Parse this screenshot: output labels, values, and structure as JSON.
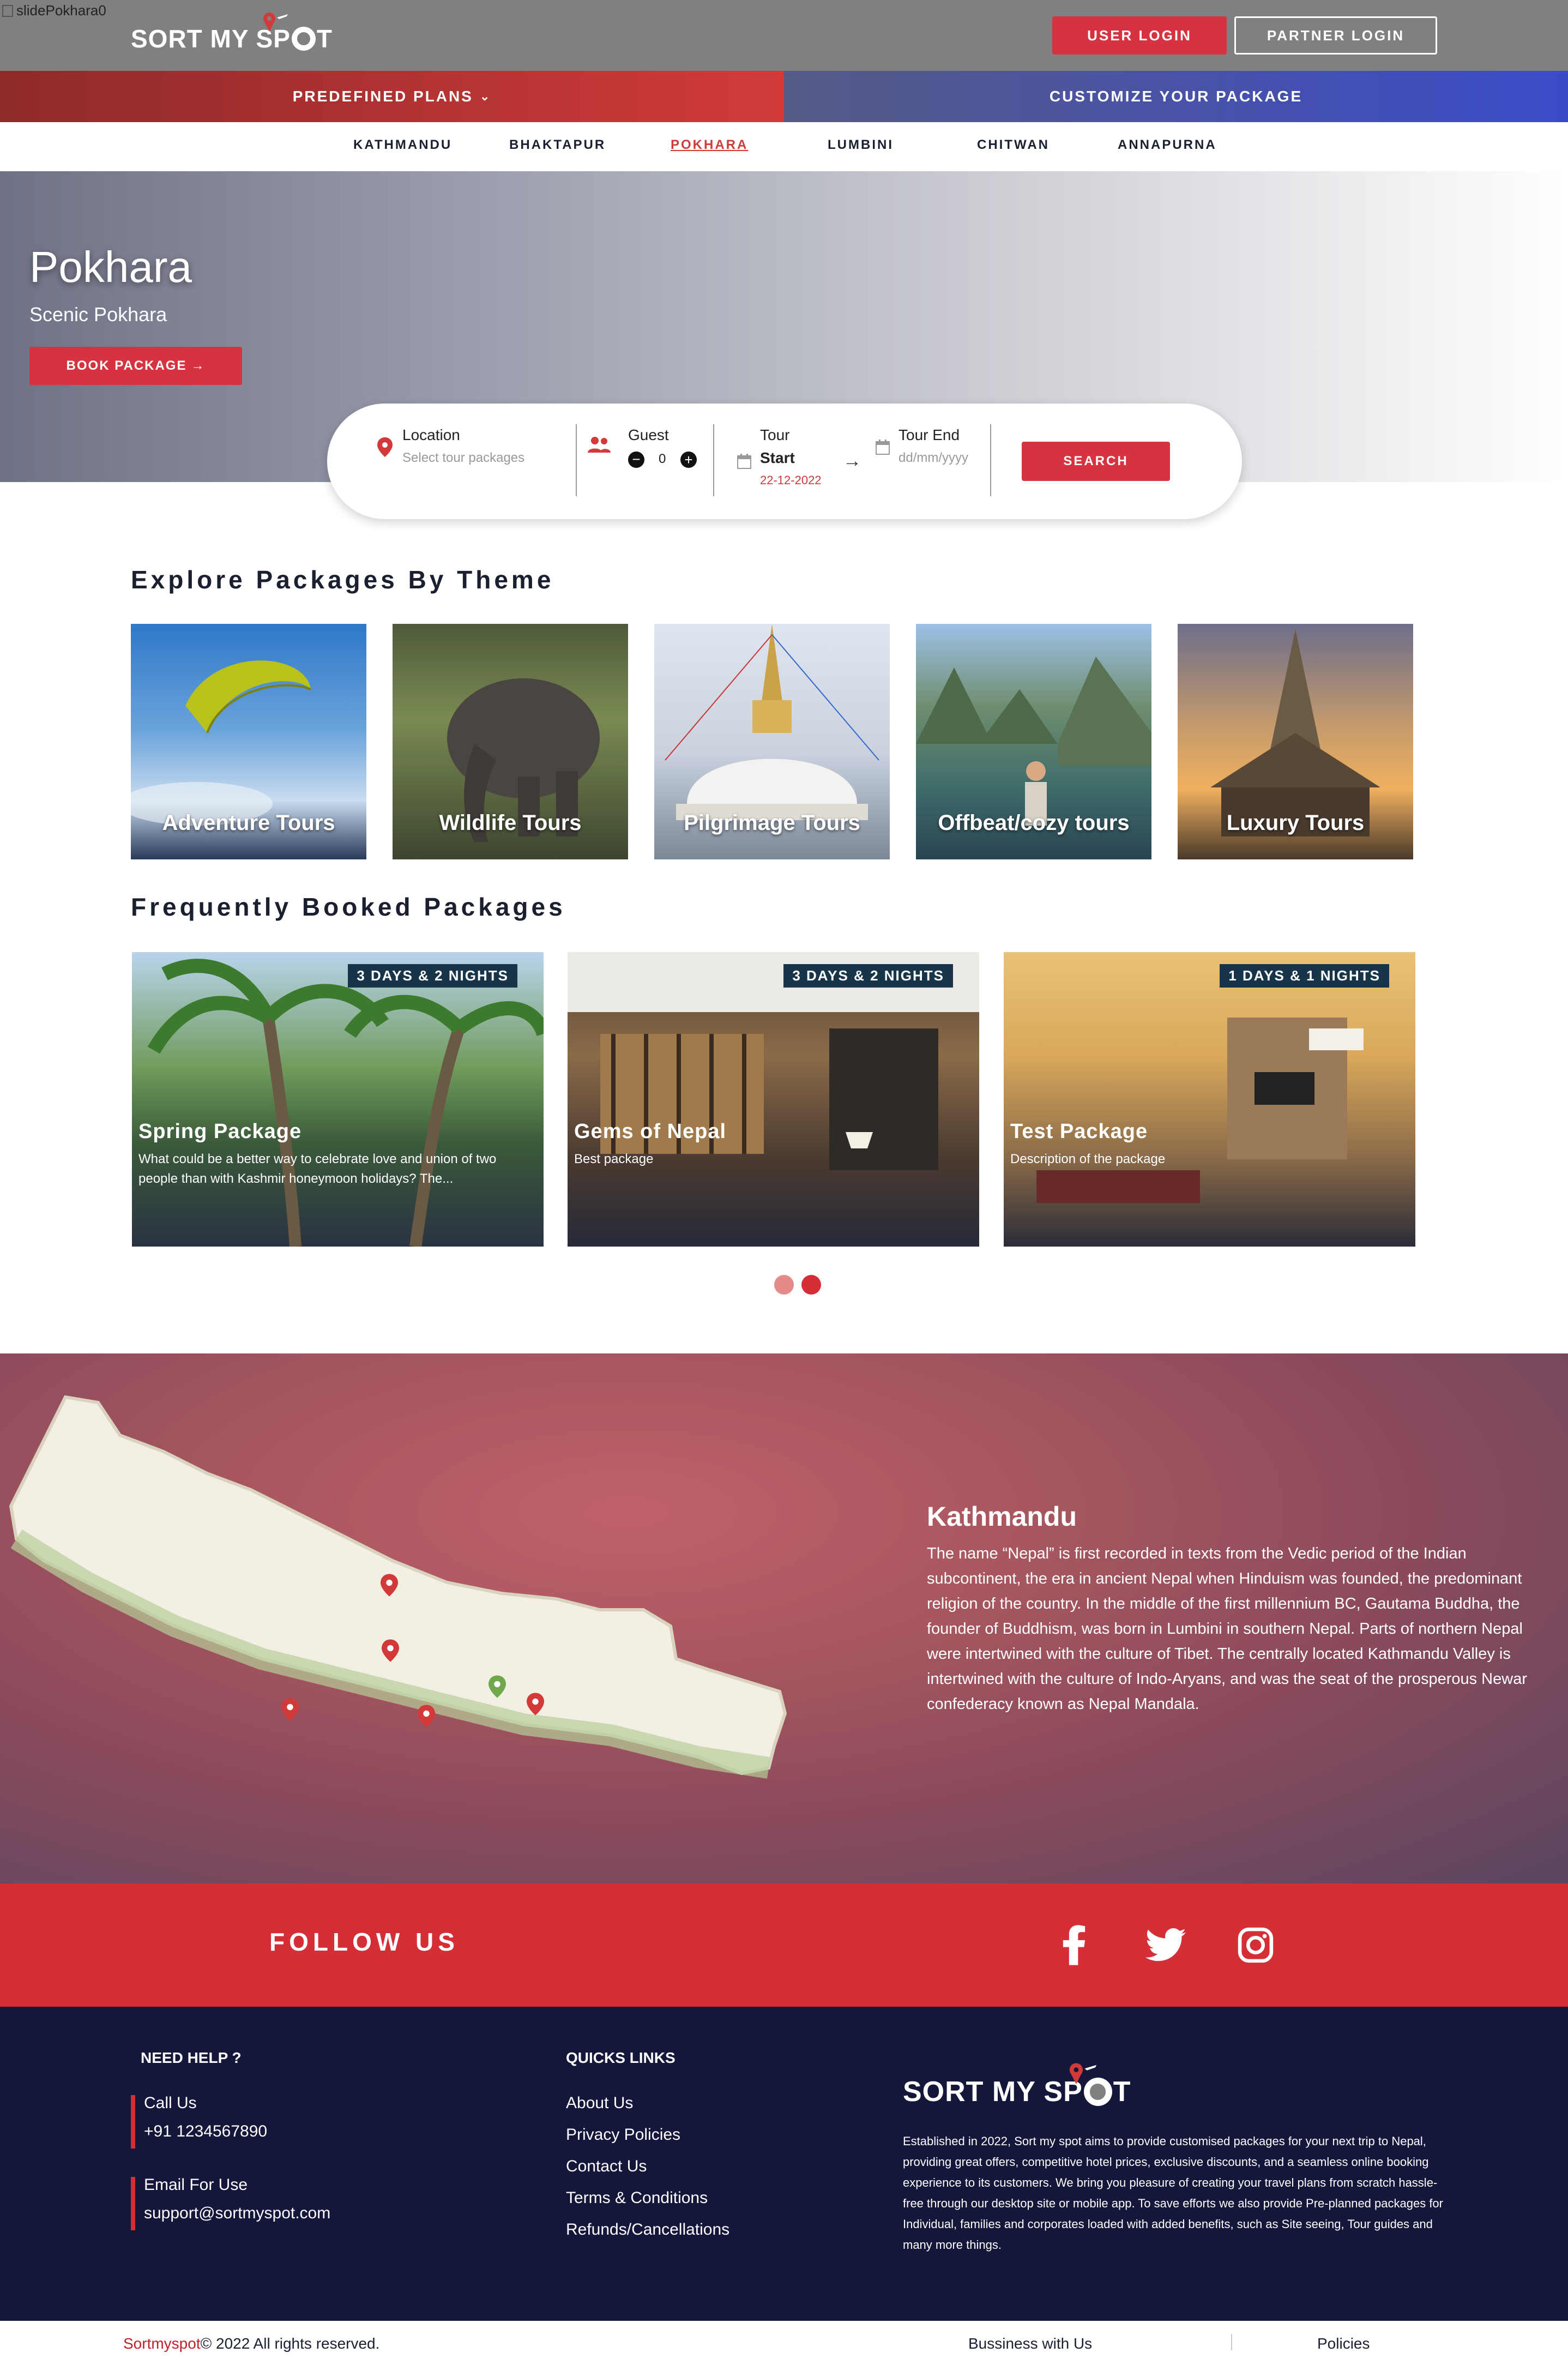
{
  "broken_image_alt": "slidePokhara0",
  "header": {
    "logo": {
      "part1": "SORT MY SP",
      "part2": "T"
    },
    "user_login": "USER LOGIN",
    "partner_login": "PARTNER LOGIN"
  },
  "nav": {
    "predefined_plans": "PREDEFINED PLANS",
    "customize": "CUSTOMIZE YOUR PACKAGE",
    "cities": [
      "KATHMANDU",
      "BHAKTAPUR",
      "POKHARA",
      "LUMBINI",
      "CHITWAN",
      "ANNAPURNA"
    ],
    "active_city": "POKHARA"
  },
  "hero": {
    "title": "Pokhara",
    "subtitle": "Scenic Pokhara",
    "book_button": "BOOK PACKAGE"
  },
  "search": {
    "location_label": "Location",
    "location_placeholder": "Select tour packages",
    "guest_label": "Guest",
    "guest_count": "0",
    "tour_start_label1": "Tour",
    "tour_start_label2": "Start",
    "tour_start_value": "22-12-2022",
    "tour_end_label": "Tour End",
    "tour_end_placeholder": "dd/mm/yyyy",
    "search_button": "SEARCH"
  },
  "themes": {
    "title": "Explore Packages By Theme",
    "items": [
      {
        "label": "Adventure Tours"
      },
      {
        "label": "Wildlife Tours"
      },
      {
        "label": "Pilgrimage Tours"
      },
      {
        "label": "Offbeat/cozy tours"
      },
      {
        "label": "Luxury Tours"
      }
    ]
  },
  "packages": {
    "title": "Frequently Booked Packages",
    "items": [
      {
        "badge": "3 DAYS & 2 NIGHTS",
        "title": "Spring Package",
        "desc": "What could be a better way to celebrate love and union of two people than with Kashmir honeymoon holidays? The..."
      },
      {
        "badge": "3 DAYS & 2 NIGHTS",
        "title": "Gems of Nepal",
        "desc": "Best package"
      },
      {
        "badge": "1 DAYS & 1 NIGHTS",
        "title": "Test Package",
        "desc": "Description of the package"
      }
    ]
  },
  "map_section": {
    "title": "Kathmandu",
    "description": "The name “Nepal” is first recorded in texts from the Vedic period of the Indian subcontinent, the era in ancient Nepal when Hinduism was founded, the predominant religion of the country. In the middle of the first millennium BC, Gautama Buddha, the founder of Buddhism, was born in Lumbini in southern Nepal. Parts of northern Nepal were intertwined with the culture of Tibet. The centrally located Kathmandu Valley is intertwined with the culture of Indo-Aryans, and was the seat of the prosperous Newar confederacy known as Nepal Mandala."
  },
  "follow": {
    "title": "FOLLOW US",
    "icons": [
      "facebook-icon",
      "twitter-icon",
      "instagram-icon"
    ]
  },
  "footer": {
    "need_help": "NEED HELP ?",
    "call_label": "Call Us",
    "call_value": "+91 1234567890",
    "email_label": "Email For Use",
    "email_value": "support@sortmyspot.com",
    "quick_links_title": "QUICKS LINKS",
    "links": [
      "About Us",
      "Privacy Policies",
      "Contact Us",
      "Terms & Conditions",
      "Refunds/Cancellations"
    ],
    "about": "Established in 2022, Sort my spot aims to provide customised packages for your next trip to Nepal, providing great offers, competitive hotel prices, exclusive discounts, and a seamless online booking experience to its customers. We bring you pleasure of creating your travel plans from scratch hassle-free through our desktop site or mobile app. To save efforts we also provide Pre-planned packages for Individual, families and corporates loaded with added benefits, such as Site seeing, Tour guides and many more things."
  },
  "bottom": {
    "brand": "Sortmyspot",
    "copyright": "© 2022 All rights reserved.",
    "business": "Bussiness with Us",
    "policies": "Policies"
  },
  "colors": {
    "accent_red": "#d6323f",
    "navy": "#15173a",
    "badge_bg": "#173448"
  }
}
